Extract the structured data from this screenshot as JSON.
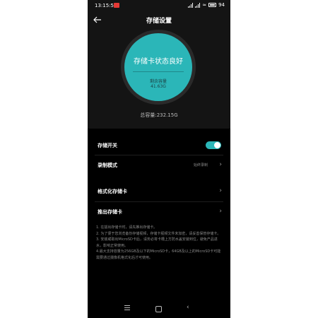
{
  "status_bar": {
    "time": "13:15:52",
    "battery": "94"
  },
  "header": {
    "title": "存储设置"
  },
  "storage": {
    "status": "存储卡状态良好",
    "remaining_label": "剩余容量",
    "remaining_value": "41.63G",
    "total": "总容量:232.15G",
    "ring_color": "#2bb6b8"
  },
  "settings": {
    "storage_switch": {
      "label": "存储开关",
      "on": true
    },
    "record_mode": {
      "label": "录制模式",
      "value": "始终录制"
    },
    "format_card": {
      "label": "格式化存储卡"
    },
    "eject_card": {
      "label": "推出存储卡"
    }
  },
  "notes": [
    "1. 在拔出存储卡时，请先推出存储卡。",
    "2. 为了便于您浏览备份存储视频，存储卡视频文件未加密，请妥善保管存储卡。",
    "3. 安装或取出MicroSD卡后，请务必将卡槽上方防水盖安装到位，避免产品进水，影响正常使用。",
    "4.最大支持容量为256GB及以下的MicroSD卡，64GB及以上的MicroSD卡可能需要通过摄像机格式化后才可使用。"
  ]
}
